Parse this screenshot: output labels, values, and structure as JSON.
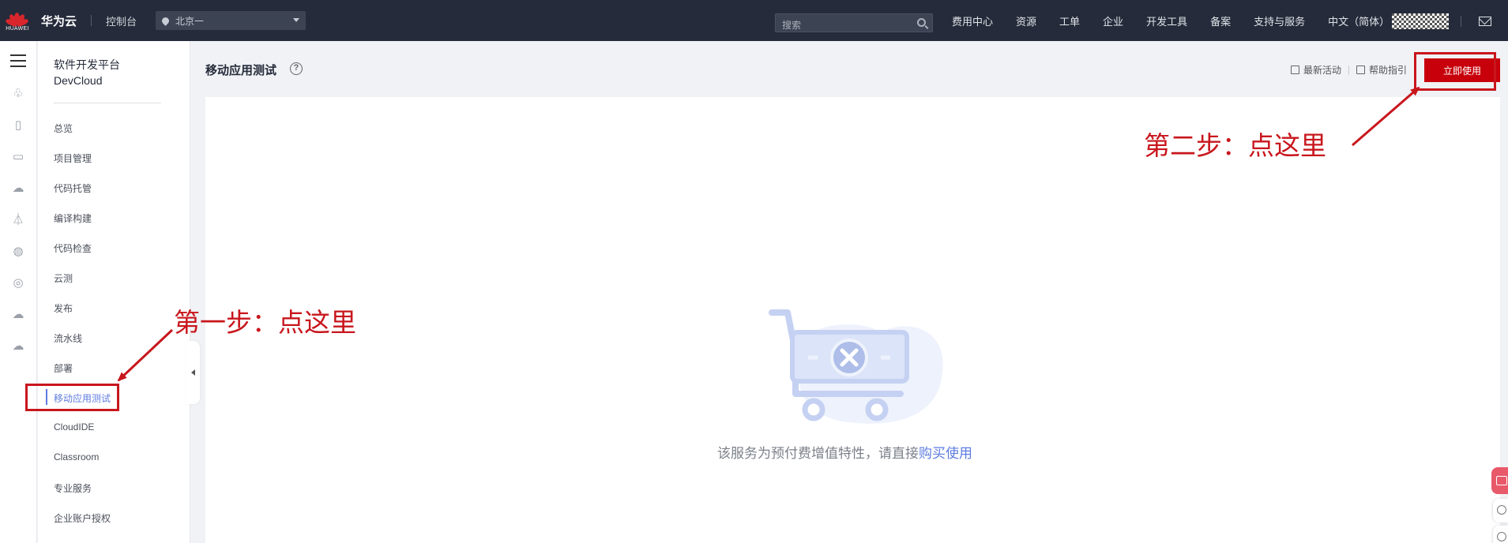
{
  "topbar": {
    "logo_text": "HUAWEI",
    "brand": "华为云",
    "console": "控制台",
    "region": "北京一",
    "search_placeholder": "搜索",
    "nav": [
      "费用中心",
      "资源",
      "工单",
      "企业",
      "开发工具",
      "备案",
      "支持与服务",
      "中文（简体）"
    ]
  },
  "sidebar": {
    "title_line1": "软件开发平台",
    "title_line2": "DevCloud",
    "items": [
      "总览",
      "项目管理",
      "代码托管",
      "编译构建",
      "代码检查",
      "云测",
      "发布",
      "流水线",
      "部署",
      "移动应用测试",
      "CloudIDE",
      "Classroom",
      "专业服务",
      "企业账户授权"
    ],
    "active_index": 9
  },
  "main": {
    "title": "移动应用测试",
    "help": "?",
    "links": [
      "最新活动",
      "帮助指引"
    ],
    "primary_button": "立即使用",
    "empty_text": "该服务为预付费增值特性，请直接",
    "empty_link": "购买使用"
  },
  "annotations": {
    "step1": "第一步：点这里",
    "step2": "第二步：点这里",
    "color": "#c8161d"
  },
  "colors": {
    "topbar": "#252b3a",
    "accent": "#5e7ce0",
    "primary": "#c7000b"
  }
}
